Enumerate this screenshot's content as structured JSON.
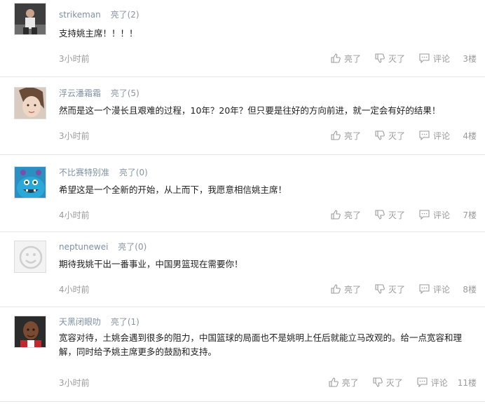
{
  "comments": [
    {
      "username": "strikeman",
      "like_label": "亮了(2)",
      "text": "支持姚主席！！！！",
      "time": "3小时前",
      "like_btn": "亮了",
      "dislike_btn": "灭了",
      "reply_btn": "评论",
      "floor": "3楼"
    },
    {
      "username": "浮云潘霜霜",
      "like_label": "亮了(5)",
      "text": "然而是这一个漫长且艰难的过程，10年？20年？但只要是往好的方向前进，就一定会有好的结果！",
      "time": "3小时前",
      "like_btn": "亮了",
      "dislike_btn": "灭了",
      "reply_btn": "评论",
      "floor": "4楼"
    },
    {
      "username": "不比赛特别准",
      "like_label": "亮了(0)",
      "text": "希望这是一个全新的开始，从上而下，我愿意相信姚主席！",
      "time": "4小时前",
      "like_btn": "亮了",
      "dislike_btn": "灭了",
      "reply_btn": "评论",
      "floor": "7楼"
    },
    {
      "username": "neptunewei",
      "like_label": "亮了(0)",
      "text": "期待我姚干出一番事业，中国男篮现在需要你！",
      "time": "4小时前",
      "like_btn": "亮了",
      "dislike_btn": "灭了",
      "reply_btn": "评论",
      "floor": "8楼"
    },
    {
      "username": "天黑闭眼叻",
      "like_label": "亮了(1)",
      "text": "宽容对待，土姚会遇到很多的阻力，中国篮球的局面也不是姚明上任后就能立马改观的。给一点宽容和理解，同时给予姚主席更多的鼓励和支持。",
      "time": "3小时前",
      "like_btn": "亮了",
      "dislike_btn": "灭了",
      "reply_btn": "评论",
      "floor": "11楼"
    }
  ],
  "colors": {
    "username": "#7f8fa4",
    "meta": "#9a9a9a",
    "text": "#1e1e1e",
    "divider": "#e6e6e6"
  }
}
